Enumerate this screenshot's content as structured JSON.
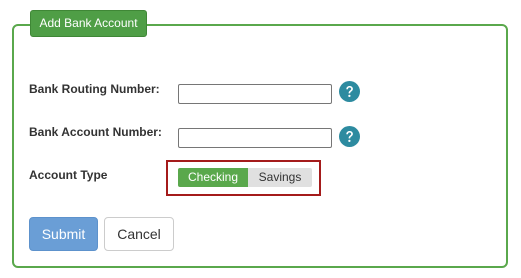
{
  "panel": {
    "title": "Add Bank Account"
  },
  "form": {
    "routing_label": "Bank Routing Number:",
    "routing_value": "",
    "account_label": "Bank Account Number:",
    "account_value": "",
    "type_label": "Account Type",
    "type_options": [
      "Checking",
      "Savings"
    ],
    "type_selected": "Checking"
  },
  "icons": {
    "routing_help": "question-circle-icon",
    "account_help": "question-circle-icon"
  },
  "buttons": {
    "submit_label": "Submit",
    "cancel_label": "Cancel"
  },
  "colors": {
    "accent_green": "#5aa84c",
    "submit_blue": "#6a9ed6",
    "highlight_red": "#a41b1b",
    "help_icon": "#2d8ba0"
  }
}
